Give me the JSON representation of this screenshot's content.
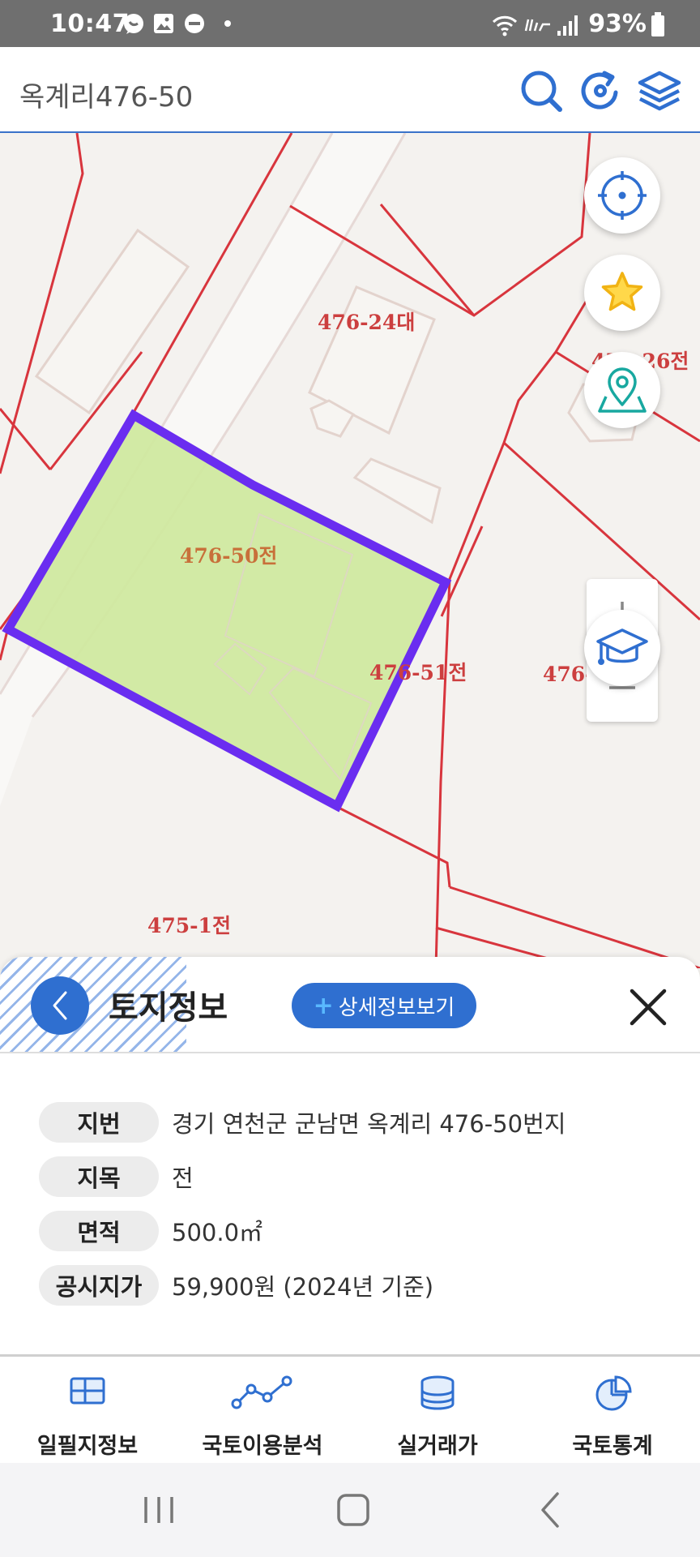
{
  "status_bar": {
    "time": "10:47",
    "battery": "93%"
  },
  "top_bar": {
    "title": "옥계리476-50"
  },
  "map": {
    "parcel_labels": [
      {
        "text": "476-24대"
      },
      {
        "text": "476-26전"
      },
      {
        "text": "476-50전"
      },
      {
        "text": "476-51전"
      },
      {
        "text": "476-52"
      },
      {
        "text": "475-1전"
      }
    ],
    "colors": {
      "boundary": "#d8353d",
      "selection": "#6a2df0",
      "selection_fill": "#d0e9a0",
      "label": "#cc3f3f"
    }
  },
  "sheet": {
    "title": "토지정보",
    "detail_button": "상세정보보기",
    "rows": [
      {
        "label": "지번",
        "value": "경기 연천군 군남면 옥계리 476-50번지"
      },
      {
        "label": "지목",
        "value": "전"
      },
      {
        "label": "면적",
        "value": "500.0㎡"
      },
      {
        "label": "공시지가",
        "value": "59,900원 (2024년 기준)"
      }
    ]
  },
  "bottom_nav": {
    "items": [
      {
        "label": "일필지정보",
        "icon": "grid-map-icon"
      },
      {
        "label": "국토이용분석",
        "icon": "line-chart-icon"
      },
      {
        "label": "실거래가",
        "icon": "database-icon"
      },
      {
        "label": "국토통계",
        "icon": "pie-chart-icon"
      }
    ]
  },
  "accent_color": "#2f6fd0"
}
